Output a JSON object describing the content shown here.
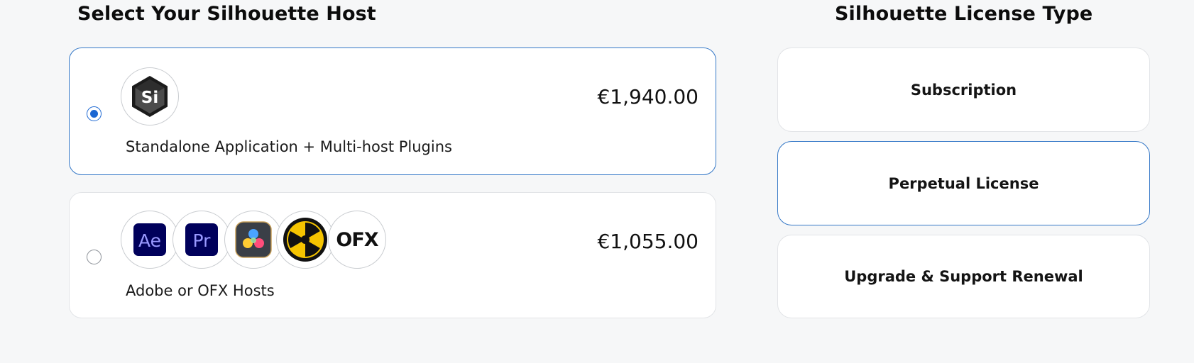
{
  "host_section": {
    "title": "Select Your Silhouette Host",
    "options": [
      {
        "selected": true,
        "price": "€1,940.00",
        "description": "Standalone Application + Multi-host Plugins",
        "logos": [
          {
            "icon": "silhouette-si-icon",
            "text": "Si"
          }
        ]
      },
      {
        "selected": false,
        "price": "€1,055.00",
        "description": "Adobe or OFX Hosts",
        "logos": [
          {
            "icon": "after-effects-icon",
            "text": "Ae"
          },
          {
            "icon": "premiere-pro-icon",
            "text": "Pr"
          },
          {
            "icon": "davinci-resolve-icon",
            "text": ""
          },
          {
            "icon": "nuke-icon",
            "text": ""
          },
          {
            "icon": "ofx-icon",
            "text": "OFX"
          }
        ]
      }
    ]
  },
  "license_section": {
    "title": "Silhouette License Type",
    "options": [
      {
        "label": "Subscription",
        "selected": false
      },
      {
        "label": "Perpetual License",
        "selected": true
      },
      {
        "label": "Upgrade & Support Renewal",
        "selected": false
      }
    ]
  },
  "colors": {
    "accent": "#1a66d2",
    "selected_border": "#3578c7",
    "background": "#f6f7f8",
    "adobe_dark": "#00005b",
    "after_effects_text": "#9999ff",
    "premiere_text": "#9999ff",
    "nuke_yellow": "#f5c400"
  }
}
